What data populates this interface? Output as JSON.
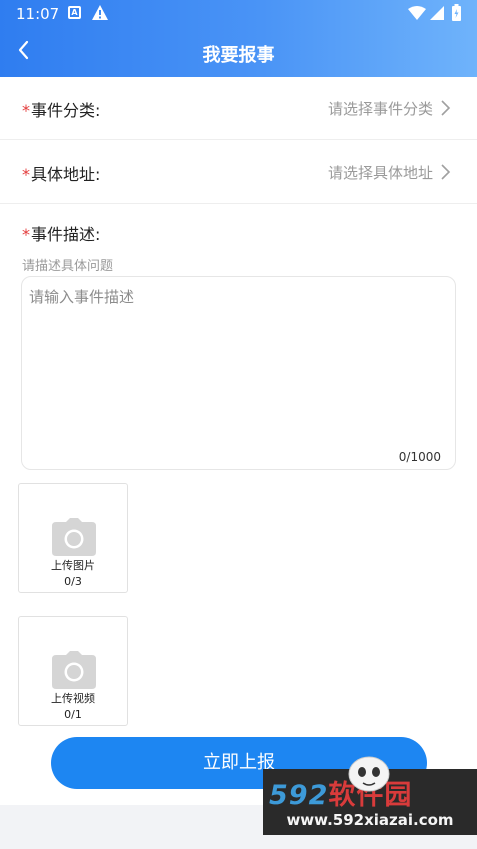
{
  "status_bar": {
    "time": "11:07",
    "a_badge": "A",
    "icons": [
      "a-badge-icon",
      "warning-icon",
      "wifi-icon",
      "signal-icon",
      "battery-icon"
    ]
  },
  "header": {
    "title": "我要报事",
    "back_icon": "chevron-left-icon",
    "gradient": [
      "#2f7df0",
      "#6fb3fb"
    ]
  },
  "form": {
    "required_mark": "*",
    "category": {
      "label": "事件分类:",
      "placeholder": "请选择事件分类"
    },
    "address": {
      "label": "具体地址:",
      "placeholder": "请选择具体地址"
    },
    "description": {
      "label": "事件描述:",
      "hint": "请描述具体问题",
      "placeholder": "请输入事件描述",
      "counter": "0/1000"
    }
  },
  "uploads": {
    "image": {
      "label": "上传图片",
      "count": "0/3",
      "icon": "camera-icon"
    },
    "video": {
      "label": "上传视频",
      "count": "0/1",
      "icon": "camera-icon"
    }
  },
  "submit": {
    "label": "立即上报",
    "color": "#1d86f2"
  },
  "watermark": {
    "digits": "592",
    "chinese": "软件园",
    "url": "www.592xiazai.com"
  },
  "colors": {
    "required": "#e43b3b",
    "placeholder": "#9a9a9a"
  }
}
